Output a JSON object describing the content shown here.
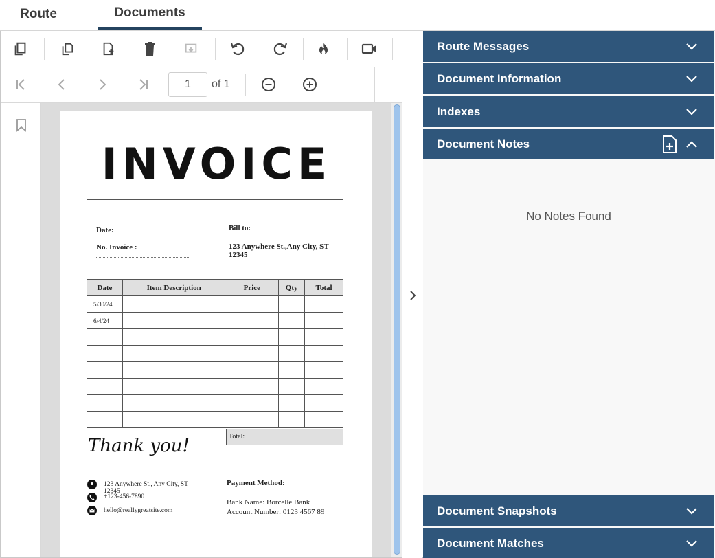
{
  "tabs": {
    "route": "Route",
    "documents": "Documents"
  },
  "toolbar": {
    "page_number": "1",
    "page_of": "of 1"
  },
  "invoice": {
    "title": "INVOICE",
    "date_label": "Date:",
    "no_invoice_label": "No. Invoice :",
    "bill_to_label": "Bill to:",
    "bill_to_address_line1": "123 Anywhere St.,Any City, ST",
    "bill_to_address_line2": "12345",
    "table": {
      "headers": [
        "Date",
        "Item Description",
        "Price",
        "Qty",
        "Total"
      ],
      "rows": [
        [
          "5/30/24",
          "",
          "",
          "",
          ""
        ],
        [
          "6/4/24",
          "",
          "",
          "",
          ""
        ],
        [
          "",
          "",
          "",
          "",
          ""
        ],
        [
          "",
          "",
          "",
          "",
          ""
        ],
        [
          "",
          "",
          "",
          "",
          ""
        ],
        [
          "",
          "",
          "",
          "",
          ""
        ],
        [
          "",
          "",
          "",
          "",
          ""
        ],
        [
          "",
          "",
          "",
          "",
          ""
        ]
      ]
    },
    "total_label": "Total:",
    "thank_you": "Thank you!",
    "contact": {
      "address_line1": "123 Anywhere St., Any City, ST",
      "address_line2": "12345",
      "phone": "+123-456-7890",
      "email": "hello@reallygreatsite.com"
    },
    "payment": {
      "heading": "Payment Method:",
      "bank_name": "Bank Name: Borcelle Bank",
      "account_number": "Account Number: 0123 4567 89"
    }
  },
  "sidebar": {
    "sections": [
      {
        "title": "Route Messages",
        "expanded": false
      },
      {
        "title": "Document Information",
        "expanded": false
      },
      {
        "title": "Indexes",
        "expanded": false
      },
      {
        "title": "Document Notes",
        "expanded": true
      },
      {
        "title": "Document Snapshots",
        "expanded": false
      },
      {
        "title": "Document Matches",
        "expanded": false
      }
    ],
    "notes_empty": "No Notes Found"
  },
  "colors": {
    "accent": "#2f567b",
    "tab_underline": "#24435f",
    "scrollbar": "#9fc4ec"
  }
}
